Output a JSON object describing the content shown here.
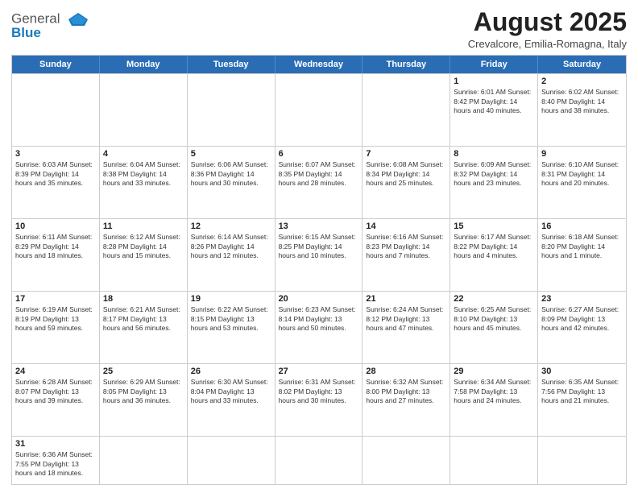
{
  "header": {
    "logo_general": "General",
    "logo_blue": "Blue",
    "month_year": "August 2025",
    "location": "Crevalcore, Emilia-Romagna, Italy"
  },
  "days_of_week": [
    "Sunday",
    "Monday",
    "Tuesday",
    "Wednesday",
    "Thursday",
    "Friday",
    "Saturday"
  ],
  "weeks": [
    [
      {
        "day": "",
        "info": ""
      },
      {
        "day": "",
        "info": ""
      },
      {
        "day": "",
        "info": ""
      },
      {
        "day": "",
        "info": ""
      },
      {
        "day": "",
        "info": ""
      },
      {
        "day": "1",
        "info": "Sunrise: 6:01 AM\nSunset: 8:42 PM\nDaylight: 14 hours\nand 40 minutes."
      },
      {
        "day": "2",
        "info": "Sunrise: 6:02 AM\nSunset: 8:40 PM\nDaylight: 14 hours\nand 38 minutes."
      }
    ],
    [
      {
        "day": "3",
        "info": "Sunrise: 6:03 AM\nSunset: 8:39 PM\nDaylight: 14 hours\nand 35 minutes."
      },
      {
        "day": "4",
        "info": "Sunrise: 6:04 AM\nSunset: 8:38 PM\nDaylight: 14 hours\nand 33 minutes."
      },
      {
        "day": "5",
        "info": "Sunrise: 6:06 AM\nSunset: 8:36 PM\nDaylight: 14 hours\nand 30 minutes."
      },
      {
        "day": "6",
        "info": "Sunrise: 6:07 AM\nSunset: 8:35 PM\nDaylight: 14 hours\nand 28 minutes."
      },
      {
        "day": "7",
        "info": "Sunrise: 6:08 AM\nSunset: 8:34 PM\nDaylight: 14 hours\nand 25 minutes."
      },
      {
        "day": "8",
        "info": "Sunrise: 6:09 AM\nSunset: 8:32 PM\nDaylight: 14 hours\nand 23 minutes."
      },
      {
        "day": "9",
        "info": "Sunrise: 6:10 AM\nSunset: 8:31 PM\nDaylight: 14 hours\nand 20 minutes."
      }
    ],
    [
      {
        "day": "10",
        "info": "Sunrise: 6:11 AM\nSunset: 8:29 PM\nDaylight: 14 hours\nand 18 minutes."
      },
      {
        "day": "11",
        "info": "Sunrise: 6:12 AM\nSunset: 8:28 PM\nDaylight: 14 hours\nand 15 minutes."
      },
      {
        "day": "12",
        "info": "Sunrise: 6:14 AM\nSunset: 8:26 PM\nDaylight: 14 hours\nand 12 minutes."
      },
      {
        "day": "13",
        "info": "Sunrise: 6:15 AM\nSunset: 8:25 PM\nDaylight: 14 hours\nand 10 minutes."
      },
      {
        "day": "14",
        "info": "Sunrise: 6:16 AM\nSunset: 8:23 PM\nDaylight: 14 hours\nand 7 minutes."
      },
      {
        "day": "15",
        "info": "Sunrise: 6:17 AM\nSunset: 8:22 PM\nDaylight: 14 hours\nand 4 minutes."
      },
      {
        "day": "16",
        "info": "Sunrise: 6:18 AM\nSunset: 8:20 PM\nDaylight: 14 hours\nand 1 minute."
      }
    ],
    [
      {
        "day": "17",
        "info": "Sunrise: 6:19 AM\nSunset: 8:19 PM\nDaylight: 13 hours\nand 59 minutes."
      },
      {
        "day": "18",
        "info": "Sunrise: 6:21 AM\nSunset: 8:17 PM\nDaylight: 13 hours\nand 56 minutes."
      },
      {
        "day": "19",
        "info": "Sunrise: 6:22 AM\nSunset: 8:15 PM\nDaylight: 13 hours\nand 53 minutes."
      },
      {
        "day": "20",
        "info": "Sunrise: 6:23 AM\nSunset: 8:14 PM\nDaylight: 13 hours\nand 50 minutes."
      },
      {
        "day": "21",
        "info": "Sunrise: 6:24 AM\nSunset: 8:12 PM\nDaylight: 13 hours\nand 47 minutes."
      },
      {
        "day": "22",
        "info": "Sunrise: 6:25 AM\nSunset: 8:10 PM\nDaylight: 13 hours\nand 45 minutes."
      },
      {
        "day": "23",
        "info": "Sunrise: 6:27 AM\nSunset: 8:09 PM\nDaylight: 13 hours\nand 42 minutes."
      }
    ],
    [
      {
        "day": "24",
        "info": "Sunrise: 6:28 AM\nSunset: 8:07 PM\nDaylight: 13 hours\nand 39 minutes."
      },
      {
        "day": "25",
        "info": "Sunrise: 6:29 AM\nSunset: 8:05 PM\nDaylight: 13 hours\nand 36 minutes."
      },
      {
        "day": "26",
        "info": "Sunrise: 6:30 AM\nSunset: 8:04 PM\nDaylight: 13 hours\nand 33 minutes."
      },
      {
        "day": "27",
        "info": "Sunrise: 6:31 AM\nSunset: 8:02 PM\nDaylight: 13 hours\nand 30 minutes."
      },
      {
        "day": "28",
        "info": "Sunrise: 6:32 AM\nSunset: 8:00 PM\nDaylight: 13 hours\nand 27 minutes."
      },
      {
        "day": "29",
        "info": "Sunrise: 6:34 AM\nSunset: 7:58 PM\nDaylight: 13 hours\nand 24 minutes."
      },
      {
        "day": "30",
        "info": "Sunrise: 6:35 AM\nSunset: 7:56 PM\nDaylight: 13 hours\nand 21 minutes."
      }
    ],
    [
      {
        "day": "31",
        "info": "Sunrise: 6:36 AM\nSunset: 7:55 PM\nDaylight: 13 hours\nand 18 minutes."
      },
      {
        "day": "",
        "info": ""
      },
      {
        "day": "",
        "info": ""
      },
      {
        "day": "",
        "info": ""
      },
      {
        "day": "",
        "info": ""
      },
      {
        "day": "",
        "info": ""
      },
      {
        "day": "",
        "info": ""
      }
    ]
  ]
}
